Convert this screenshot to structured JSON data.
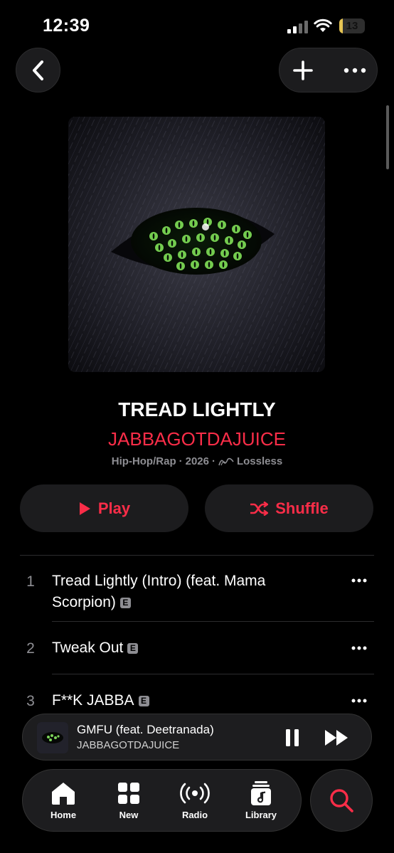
{
  "status_bar": {
    "time": "12:39",
    "battery_level": "13",
    "battery_fraction": 0.13
  },
  "top_controls": {
    "back_icon": "chevron-left-icon",
    "add_icon": "plus-icon",
    "more_icon": "ellipsis-icon"
  },
  "album": {
    "title": "TREAD LIGHTLY",
    "artist": "JABBAGOTDAJUICE",
    "genre": "Hip-Hop/Rap",
    "separator": "·",
    "year": "2026",
    "quality": "Lossless"
  },
  "actions": {
    "play_label": "Play",
    "shuffle_label": "Shuffle"
  },
  "tracks": [
    {
      "number": "1",
      "title": "Tread Lightly (Intro) (feat. Mama Scorpion)",
      "explicit": "E"
    },
    {
      "number": "2",
      "title": "Tweak Out",
      "explicit": "E"
    },
    {
      "number": "3",
      "title": "F**K JABBA",
      "explicit": "E"
    }
  ],
  "now_playing": {
    "title": "GMFU (feat. Deetranada)",
    "artist": "JABBAGOTDAJUICE"
  },
  "tab_bar": {
    "tabs": [
      {
        "label": "Home",
        "icon": "home-icon"
      },
      {
        "label": "New",
        "icon": "grid-icon"
      },
      {
        "label": "Radio",
        "icon": "radio-icon"
      },
      {
        "label": "Library",
        "icon": "library-icon"
      }
    ],
    "search_icon": "search-icon"
  },
  "colors": {
    "accent": "#fa2d48",
    "background": "#000000",
    "surface": "#1c1c1e",
    "secondary_text": "#8e8e93",
    "battery": "#e5c453"
  }
}
